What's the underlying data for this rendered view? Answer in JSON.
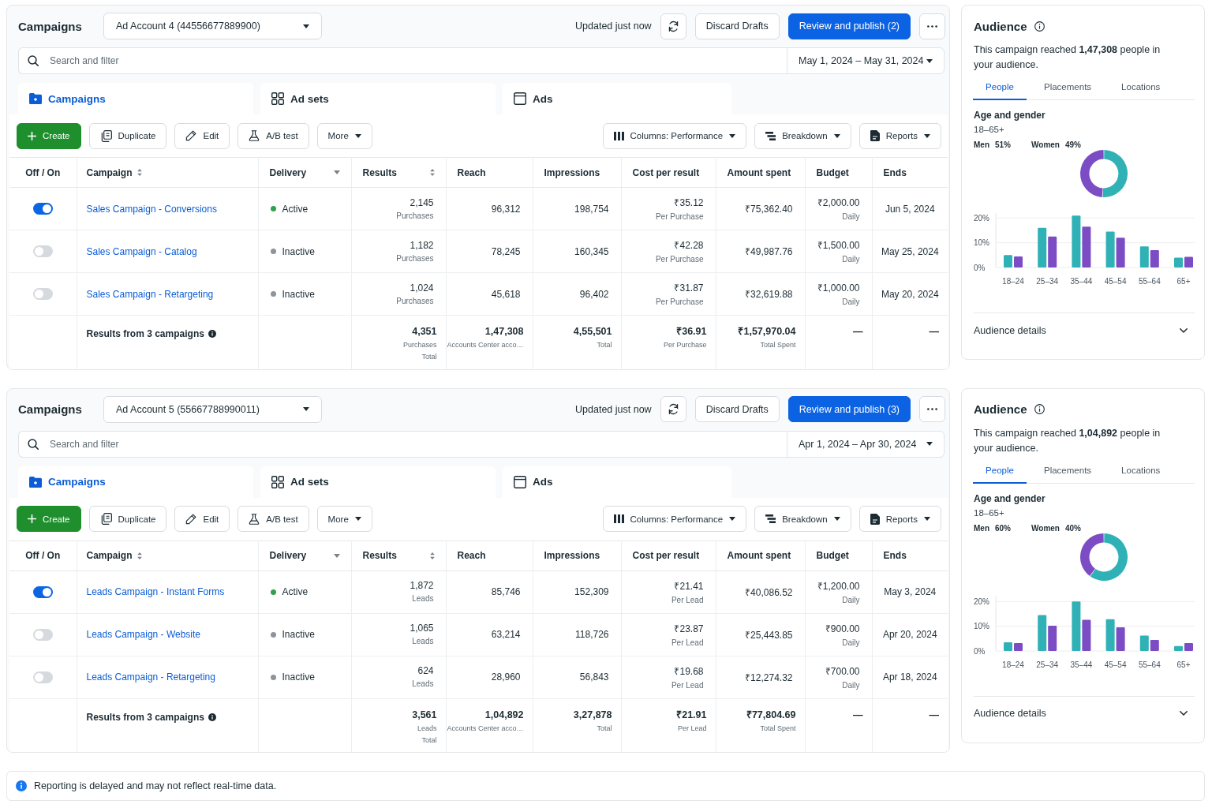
{
  "sections": [
    {
      "header": {
        "title": "Campaigns",
        "account": "Ad Account 4 (44556677889900)",
        "status": "Updated just now",
        "discard_button": "Discard Drafts",
        "publish_button": "Review and publish (2)"
      },
      "search": {
        "placeholder": "Search and filter",
        "date_range": "May 1, 2024 – May 31, 2024"
      },
      "tabs": [
        {
          "label": "Campaigns",
          "selected": true
        },
        {
          "label": "Ad sets",
          "selected": false
        },
        {
          "label": "Ads",
          "selected": false
        }
      ],
      "toolbar_left": [
        {
          "label": "Create",
          "kind": "primary"
        },
        {
          "label": "Duplicate",
          "kind": "default"
        },
        {
          "label": "Edit",
          "kind": "default"
        },
        {
          "label": "A/B test",
          "kind": "default"
        },
        {
          "label": "More",
          "kind": "menu"
        }
      ],
      "toolbar_right": [
        {
          "label": "Columns: Performance",
          "kind": "menu"
        },
        {
          "label": "Breakdown",
          "kind": "menu"
        },
        {
          "label": "Reports",
          "kind": "menu"
        }
      ],
      "table": {
        "columns": [
          {
            "label": "Off / On",
            "kind": "plain"
          },
          {
            "label": "Campaign",
            "kind": "sortable"
          },
          {
            "label": "Delivery",
            "kind": "filter"
          },
          {
            "label": "Results",
            "kind": "sortable"
          },
          {
            "label": "Reach",
            "kind": "plain"
          },
          {
            "label": "Impressions",
            "kind": "plain"
          },
          {
            "label": "Cost per result",
            "kind": "plain"
          },
          {
            "label": "Amount spent",
            "kind": "plain"
          },
          {
            "label": "Budget",
            "kind": "plain"
          },
          {
            "label": "Ends",
            "kind": "plain"
          }
        ],
        "rows": [
          {
            "on": true,
            "name": "Sales Campaign - Conversions",
            "delivery": {
              "label": "Active",
              "color": "#31a24c"
            },
            "results": {
              "value": "2,145",
              "unit": "Purchases"
            },
            "reach": "96,312",
            "impressions": "198,754",
            "cost": {
              "value": "₹35.12",
              "unit": "Per Purchase"
            },
            "amount": "₹75,362.40",
            "budget": {
              "value": "₹2,000.00",
              "unit": "Daily"
            },
            "ends": "Jun 5, 2024"
          },
          {
            "on": false,
            "name": "Sales Campaign - Catalog",
            "delivery": {
              "label": "Inactive",
              "color": "#8d949e"
            },
            "results": {
              "value": "1,182",
              "unit": "Purchases"
            },
            "reach": "78,245",
            "impressions": "160,345",
            "cost": {
              "value": "₹42.28",
              "unit": "Per Purchase"
            },
            "amount": "₹49,987.76",
            "budget": {
              "value": "₹1,500.00",
              "unit": "Daily"
            },
            "ends": "May 25, 2024"
          },
          {
            "on": false,
            "name": "Sales Campaign - Retargeting",
            "delivery": {
              "label": "Inactive",
              "color": "#8d949e"
            },
            "results": {
              "value": "1,024",
              "unit": "Purchases"
            },
            "reach": "45,618",
            "impressions": "96,402",
            "cost": {
              "value": "₹31.87",
              "unit": "Per Purchase"
            },
            "amount": "₹32,619.88",
            "budget": {
              "value": "₹1,000.00",
              "unit": "Daily"
            },
            "ends": "May 20, 2024"
          }
        ],
        "summary": {
          "label": "Results from 3 campaigns",
          "cells": [
            {
              "value": "4,351",
              "notes": [
                "Purchases",
                "Total"
              ]
            },
            {
              "value": "1,47,308",
              "notes": [
                "Accounts Center acco…"
              ]
            },
            {
              "value": "4,55,501",
              "notes": [
                "Total"
              ]
            },
            {
              "value": "₹36.91",
              "notes": [
                "Per Purchase"
              ]
            },
            {
              "value": "₹1,57,970.04",
              "notes": [
                "Total Spent"
              ]
            },
            {
              "value": "—"
            },
            {
              "value": "—"
            }
          ]
        }
      },
      "audience": {
        "title": "Audience",
        "summary": "This campaign reached **1,47,308** people in your audience.",
        "tabs": [
          {
            "label": "People",
            "selected": true
          },
          {
            "label": "Placements",
            "selected": false
          },
          {
            "label": "Locations",
            "selected": false
          }
        ],
        "section_title": "Age and gender",
        "age_range": "18–65+",
        "gender_chart": {
          "chart_data": {
            "type": "donut",
            "values": [
              51,
              49
            ],
            "value_labels": [
              "51%",
              "49%"
            ]
          }
        },
        "age_chart": {
          "chart_data": {
            "type": "bar",
            "categories": [
              "18–24",
              "25–34",
              "35–44",
              "45–54",
              "55–64",
              "65+"
            ],
            "series": [
              {
                "name": "Men",
                "color": "#2fb1b5",
                "values": [
                  5,
                  16,
                  21,
                  14.5,
                  8.5,
                  4
                ]
              },
              {
                "name": "Women",
                "color": "#7b4cc4",
                "values": [
                  4.5,
                  12.5,
                  16.5,
                  12,
                  7,
                  4.3
                ]
              }
            ],
            "ylim": [
              0,
              22
            ],
            "yticks": [
              {
                "value": 0,
                "label": "0%"
              },
              {
                "value": 10,
                "label": "10%"
              },
              {
                "value": 20,
                "label": "20%"
              }
            ]
          }
        },
        "details": {
          "label": "Audience details",
          "expanded": false
        }
      }
    },
    {
      "header": {
        "title": "Campaigns",
        "account": "Ad Account 5 (55667788990011)",
        "status": "Updated just now",
        "discard_button": "Discard Drafts",
        "publish_button": "Review and publish (3)"
      },
      "search": {
        "placeholder": "Search and filter",
        "date_range": "Apr 1, 2024 – Apr 30, 2024"
      },
      "tabs": [
        {
          "label": "Campaigns",
          "selected": true
        },
        {
          "label": "Ad sets",
          "selected": false
        },
        {
          "label": "Ads",
          "selected": false
        }
      ],
      "toolbar_left": [
        {
          "label": "Create",
          "kind": "primary"
        },
        {
          "label": "Duplicate",
          "kind": "default"
        },
        {
          "label": "Edit",
          "kind": "default"
        },
        {
          "label": "A/B test",
          "kind": "default"
        },
        {
          "label": "More",
          "kind": "menu"
        }
      ],
      "toolbar_right": [
        {
          "label": "Columns: Performance",
          "kind": "menu"
        },
        {
          "label": "Breakdown",
          "kind": "menu"
        },
        {
          "label": "Reports",
          "kind": "menu"
        }
      ],
      "table": {
        "columns": [
          {
            "label": "Off / On",
            "kind": "plain"
          },
          {
            "label": "Campaign",
            "kind": "sortable"
          },
          {
            "label": "Delivery",
            "kind": "filter"
          },
          {
            "label": "Results",
            "kind": "sortable"
          },
          {
            "label": "Reach",
            "kind": "plain"
          },
          {
            "label": "Impressions",
            "kind": "plain"
          },
          {
            "label": "Cost per result",
            "kind": "plain"
          },
          {
            "label": "Amount spent",
            "kind": "plain"
          },
          {
            "label": "Budget",
            "kind": "plain"
          },
          {
            "label": "Ends",
            "kind": "plain"
          }
        ],
        "rows": [
          {
            "on": true,
            "name": "Leads Campaign - Instant Forms",
            "delivery": {
              "label": "Active",
              "color": "#31a24c"
            },
            "results": {
              "value": "1,872",
              "unit": "Leads"
            },
            "reach": "85,746",
            "impressions": "152,309",
            "cost": {
              "value": "₹21.41",
              "unit": "Per Lead"
            },
            "amount": "₹40,086.52",
            "budget": {
              "value": "₹1,200.00",
              "unit": "Daily"
            },
            "ends": "May 3, 2024"
          },
          {
            "on": false,
            "name": "Leads Campaign - Website",
            "delivery": {
              "label": "Inactive",
              "color": "#8d949e"
            },
            "results": {
              "value": "1,065",
              "unit": "Leads"
            },
            "reach": "63,214",
            "impressions": "118,726",
            "cost": {
              "value": "₹23.87",
              "unit": "Per Lead"
            },
            "amount": "₹25,443.85",
            "budget": {
              "value": "₹900.00",
              "unit": "Daily"
            },
            "ends": "Apr 20, 2024"
          },
          {
            "on": false,
            "name": "Leads Campaign - Retargeting",
            "delivery": {
              "label": "Inactive",
              "color": "#8d949e"
            },
            "results": {
              "value": "624",
              "unit": "Leads"
            },
            "reach": "28,960",
            "impressions": "56,843",
            "cost": {
              "value": "₹19.68",
              "unit": "Per Lead"
            },
            "amount": "₹12,274.32",
            "budget": {
              "value": "₹700.00",
              "unit": "Daily"
            },
            "ends": "Apr 18, 2024"
          }
        ],
        "summary": {
          "label": "Results from 3 campaigns",
          "cells": [
            {
              "value": "3,561",
              "notes": [
                "Leads",
                "Total"
              ]
            },
            {
              "value": "1,04,892",
              "notes": [
                "Accounts Center acco…"
              ]
            },
            {
              "value": "3,27,878",
              "notes": [
                "Total"
              ]
            },
            {
              "value": "₹21.91",
              "notes": [
                "Per Lead"
              ]
            },
            {
              "value": "₹77,804.69",
              "notes": [
                "Total Spent"
              ]
            },
            {
              "value": "—"
            },
            {
              "value": "—"
            }
          ]
        }
      },
      "audience": {
        "title": "Audience",
        "summary": "This campaign reached **1,04,892** people in your audience.",
        "tabs": [
          {
            "label": "People",
            "selected": true
          },
          {
            "label": "Placements",
            "selected": false
          },
          {
            "label": "Locations",
            "selected": false
          }
        ],
        "section_title": "Age and gender",
        "age_range": "18–65+",
        "gender_chart": {
          "chart_data": {
            "type": "donut",
            "values": [
              60,
              40
            ],
            "value_labels": [
              "60%",
              "40%"
            ]
          }
        },
        "age_chart": {
          "chart_data": {
            "type": "bar",
            "categories": [
              "18–24",
              "25–34",
              "35–44",
              "45–54",
              "55–64",
              "65+"
            ],
            "series": [
              {
                "name": "Men",
                "color": "#2fb1b5",
                "values": [
                  3.5,
                  14.5,
                  20,
                  12.8,
                  6.2,
                  2
                ]
              },
              {
                "name": "Women",
                "color": "#7b4cc4",
                "values": [
                  3.2,
                  10.2,
                  12.6,
                  9.6,
                  4.5,
                  3.2
                ]
              }
            ],
            "ylim": [
              0,
              22
            ],
            "yticks": [
              {
                "value": 0,
                "label": "0%"
              },
              {
                "value": 10,
                "label": "10%"
              },
              {
                "value": 20,
                "label": "20%"
              }
            ]
          }
        },
        "details": {
          "label": "Audience details",
          "expanded": false
        }
      }
    }
  ],
  "notice": "Reporting is delayed and may not reflect real-time data."
}
